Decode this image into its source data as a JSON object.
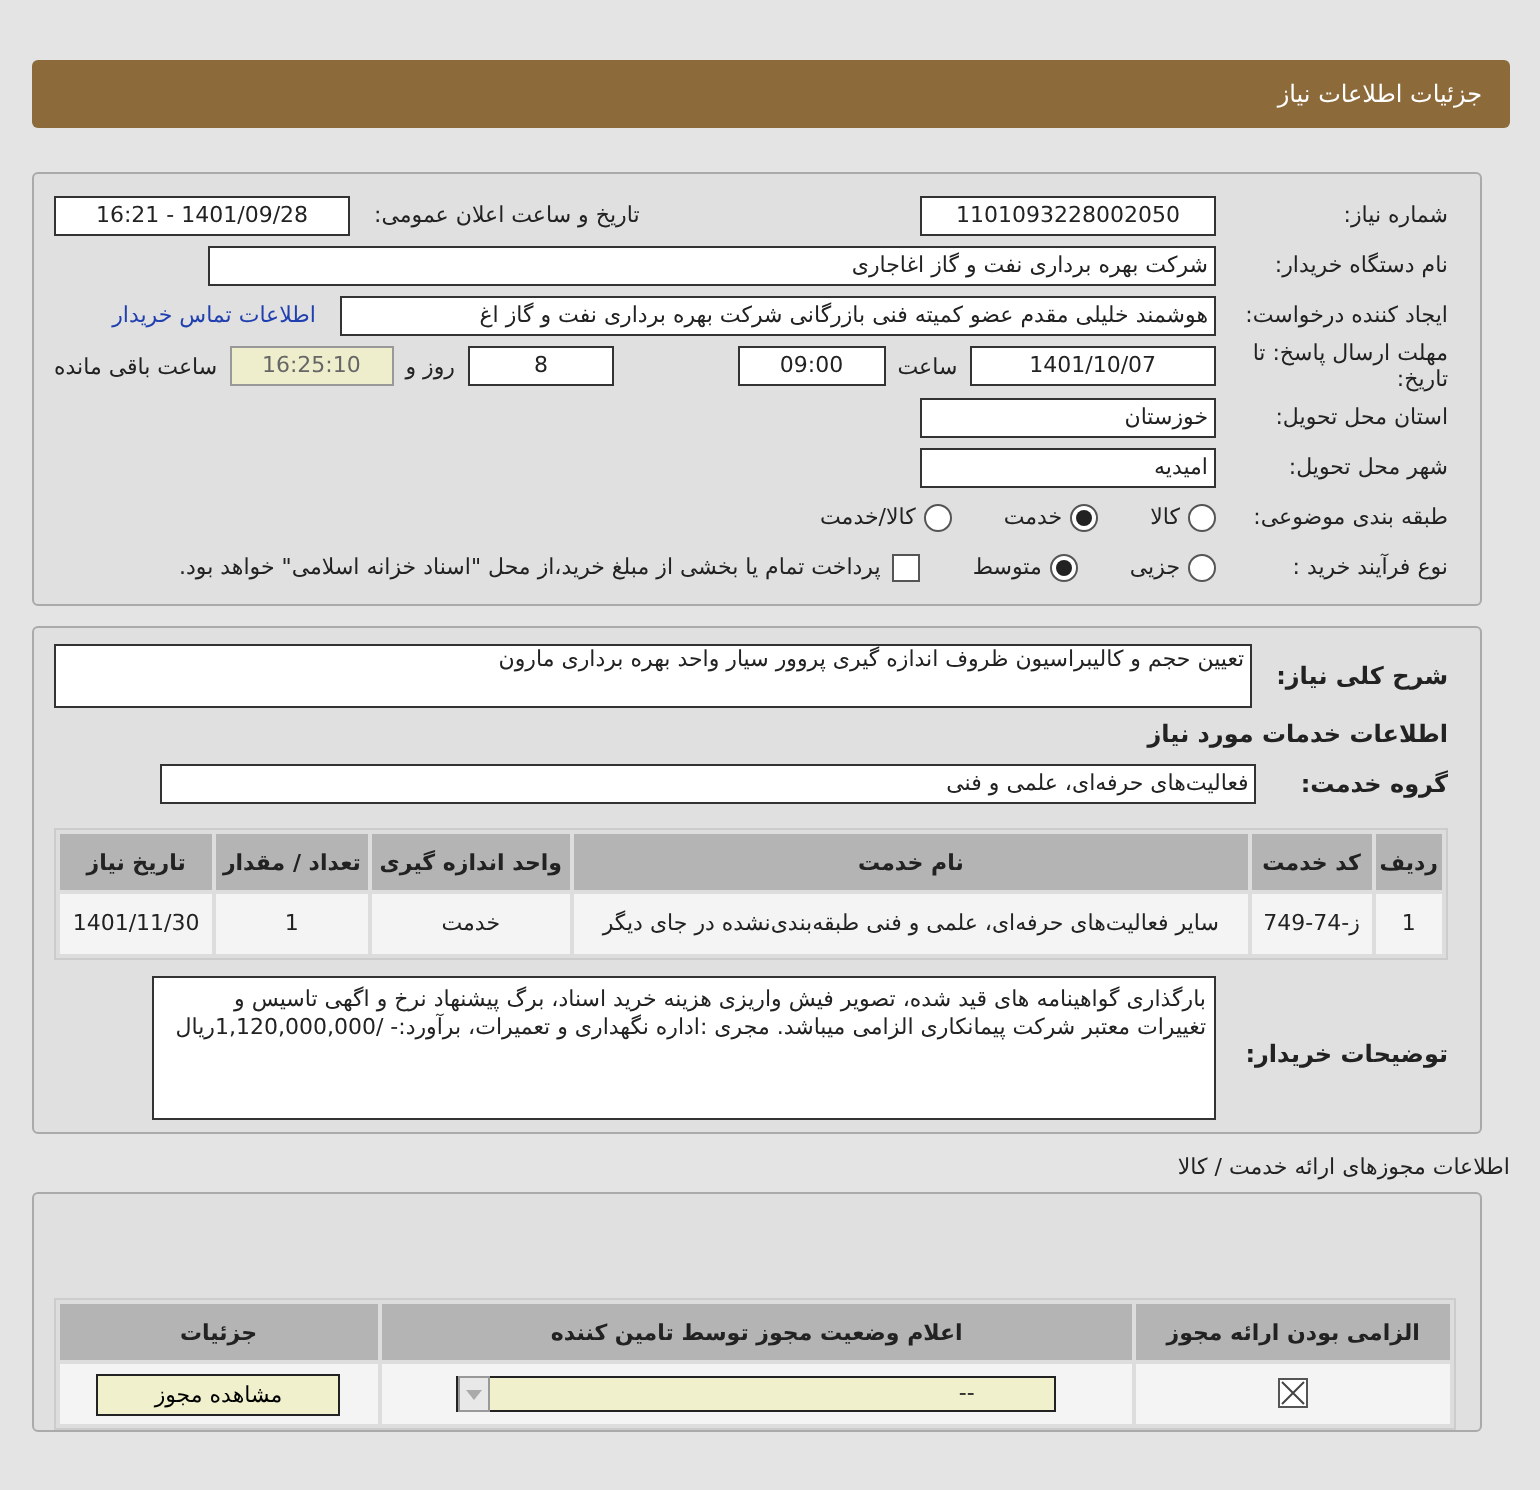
{
  "header": {
    "title": "جزئیات اطلاعات نیاز"
  },
  "need_number": {
    "label": "شماره نیاز:",
    "value": "1101093228002050"
  },
  "announce": {
    "label": "تاریخ و ساعت اعلان عمومی:",
    "value": "1401/09/28 - 16:21"
  },
  "buyer_org": {
    "label": "نام دستگاه خریدار:",
    "value": "شرکت بهره برداری نفت و گاز اغاجاری"
  },
  "requester": {
    "label": "ایجاد کننده درخواست:",
    "value": "هوشمند خلیلی مقدم عضو کمیته فنی بازرگانی شرکت بهره برداری نفت و گاز اغ",
    "link": "اطلاعات تماس خریدار"
  },
  "deadline": {
    "label": "مهلت ارسال پاسخ: تا تاریخ:",
    "date": "1401/10/07",
    "time_label": "ساعت",
    "time": "09:00",
    "days": "8",
    "days_label": "روز و",
    "remaining": "16:25:10",
    "remaining_label": "ساعت باقی مانده"
  },
  "province": {
    "label": "استان محل تحویل:",
    "value": "خوزستان"
  },
  "city": {
    "label": "شهر محل تحویل:",
    "value": "امیدیه"
  },
  "category": {
    "label": "طبقه بندی موضوعی:",
    "options": [
      {
        "label": "کالا",
        "selected": false
      },
      {
        "label": "خدمت",
        "selected": true
      },
      {
        "label": "کالا/خدمت",
        "selected": false
      }
    ]
  },
  "process": {
    "label": "نوع فرآیند خرید :",
    "options": [
      {
        "label": "جزیی",
        "selected": false
      },
      {
        "label": "متوسط",
        "selected": true
      }
    ],
    "payment": {
      "checked": false,
      "label": "پرداخت تمام یا بخشی از مبلغ خرید،از محل \"اسناد خزانه اسلامی\" خواهد بود."
    }
  },
  "summary": {
    "label": "شرح کلی نیاز:",
    "value": "تعیین حجم و کالیبراسیون ظروف اندازه گیری پروور سیار واحد بهره برداری مارون"
  },
  "services_title": "اطلاعات خدمات مورد نیاز",
  "service_group": {
    "label": "گروه خدمت:",
    "value": "فعالیت‌های حرفه‌ای، علمی و فنی"
  },
  "table": {
    "columns": [
      "ردیف",
      "کد خدمت",
      "نام خدمت",
      "واحد اندازه گیری",
      "تعداد / مقدار",
      "تاریخ نیاز"
    ],
    "rows": [
      [
        "1",
        "ز-74-749",
        "سایر فعالیت‌های حرفه‌ای، علمی و فنی طبقه‌بندی‌نشده در جای دیگر",
        "خدمت",
        "1",
        "1401/11/30"
      ]
    ]
  },
  "buyer_notes": {
    "label": "توضیحات خریدار:",
    "value": "بارگذاری گواهینامه های قید شده، تصویر فیش واریزی هزینه خرید اسناد، برگ پیشنهاد نرخ و اگهی تاسیس و تغییرات معتبر شرکت پیمانکاری الزامی میباشد. مجری :اداره نگهداری و تعمیرات، برآورد:- /1,120,000,000ریال"
  },
  "permits": {
    "title": "اطلاعات مجوزهای ارائه خدمت / کالا",
    "columns": [
      "الزامی بودن ارائه مجوز",
      "اعلام وضعیت مجوز توسط تامین کننده",
      "جزئیات"
    ],
    "rows": [
      {
        "required": true,
        "status": "--",
        "button": "مشاهده مجوز"
      }
    ]
  }
}
